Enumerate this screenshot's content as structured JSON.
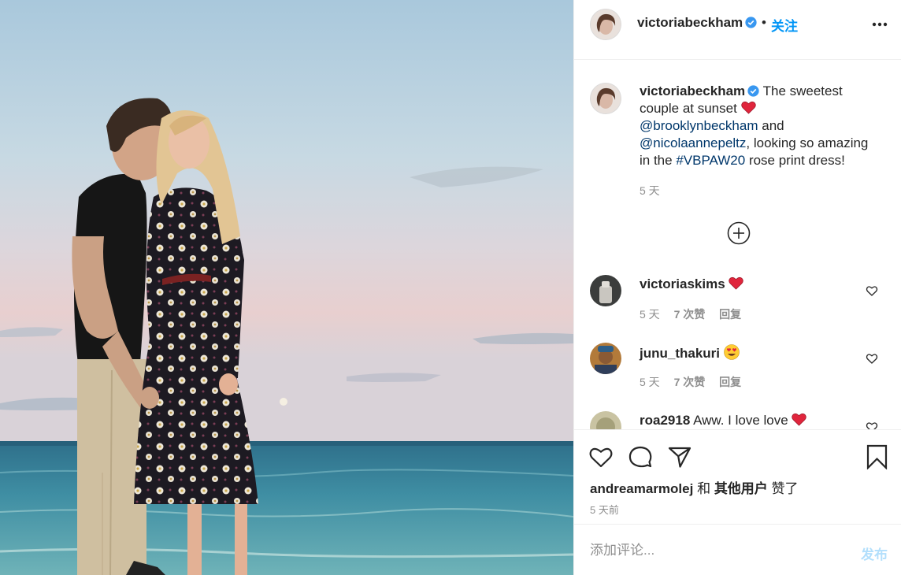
{
  "header": {
    "username": "victoriabeckham",
    "separator": "•",
    "follow_label": "关注"
  },
  "caption": {
    "username": "victoriabeckham",
    "text_1": "The sweetest couple at sunset",
    "mention_1": "@brooklynbeckham",
    "and": "and",
    "mention_2": "@nicolaannepeltz",
    "text_2": ", looking so amazing in the",
    "hashtag": "#VBPAW20",
    "text_3": "rose print dress!",
    "time": "5 天"
  },
  "comments": [
    {
      "username": "victoriaskims",
      "text": "",
      "emoji": "red-heart",
      "time": "5 天",
      "likes": "7 次赞",
      "reply": "回复"
    },
    {
      "username": "junu_thakuri",
      "text": "",
      "emoji": "heart-eyes",
      "time": "5 天",
      "likes": "7 次赞",
      "reply": "回复"
    },
    {
      "username": "roa2918",
      "text": "Aww. I love love",
      "emoji": "red-heart",
      "time": "",
      "likes": "",
      "reply": ""
    }
  ],
  "likes": {
    "liker": "andreamarmolej",
    "and": "和",
    "others": "其他用户",
    "suffix": "赞了"
  },
  "post_time": "5 天前",
  "add_comment": {
    "placeholder": "添加评论...",
    "publish_label": "发布"
  },
  "colors": {
    "accent": "#0095f6",
    "verified": "#3897f0",
    "heart": "#ed4956",
    "muted": "#8e8e8e",
    "publish_disabled": "#b2dffc"
  }
}
